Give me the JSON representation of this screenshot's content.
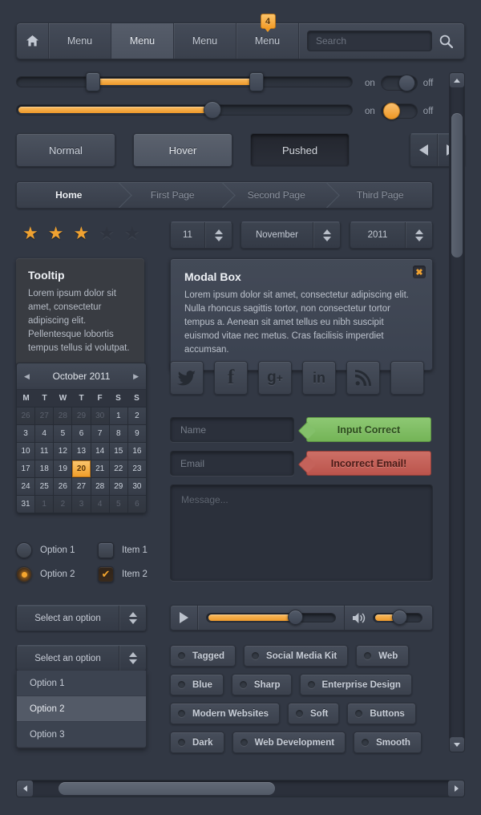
{
  "colors": {
    "background": "#323844",
    "panel": "#3d4450",
    "accent_orange": "#f0a231",
    "success_green": "#7ab85c",
    "error_red": "#c2605a",
    "text": "#c9ced8"
  },
  "topnav": {
    "home_icon": "home-icon",
    "items": [
      {
        "label": "Menu",
        "active": false
      },
      {
        "label": "Menu",
        "active": true
      },
      {
        "label": "Menu",
        "active": false
      },
      {
        "label": "Menu",
        "active": false,
        "badge": "4"
      }
    ],
    "badge": "4",
    "search": {
      "value": "",
      "placeholder": "Search",
      "icon": "search-icon"
    }
  },
  "sliders": [
    {
      "name": "range-slider",
      "start_pct": 20,
      "end_pct": 70
    },
    {
      "name": "value-slider",
      "value_pct": 57
    }
  ],
  "toggles": [
    {
      "on_label": "on",
      "off_label": "off",
      "state": "off"
    },
    {
      "on_label": "on",
      "off_label": "off",
      "state": "on"
    }
  ],
  "state_buttons": [
    {
      "label": "Normal",
      "state": "normal"
    },
    {
      "label": "Hover",
      "state": "hover"
    },
    {
      "label": "Pushed",
      "state": "pushed"
    }
  ],
  "pager": {
    "prev_icon": "arrow-left-icon",
    "next_icon": "arrow-right-icon"
  },
  "breadcrumb": [
    {
      "label": "Home",
      "active": true
    },
    {
      "label": "First Page",
      "active": false
    },
    {
      "label": "Second Page",
      "active": false
    },
    {
      "label": "Third Page",
      "active": false
    }
  ],
  "rating": {
    "filled": 3,
    "total": 5
  },
  "spinners": [
    {
      "name": "day-spinner",
      "value": "11"
    },
    {
      "name": "month-spinner",
      "value": "November"
    },
    {
      "name": "year-spinner",
      "value": "2011"
    }
  ],
  "tooltip": {
    "title": "Tooltip",
    "body": "Lorem ipsum dolor sit amet, consectetur adipiscing elit. Pellentesque lobortis tempus tellus id volutpat."
  },
  "modal": {
    "title": "Modal Box",
    "body": "Lorem ipsum dolor sit amet, consectetur adipiscing elit. Nulla rhoncus sagittis tortor, non consectetur tortor tempus a. Aenean sit amet tellus eu nibh suscipit euismod vitae nec metus. Cras facilisis imperdiet accumsan.",
    "close_label": "✖"
  },
  "calendar": {
    "title": "October 2011",
    "prev_icon": "chevron-left-icon",
    "next_icon": "chevron-right-icon",
    "dow": [
      "M",
      "T",
      "W",
      "T",
      "F",
      "S",
      "S"
    ],
    "selected": 20,
    "weeks": [
      [
        {
          "d": "26",
          "mute": true
        },
        {
          "d": "27",
          "mute": true
        },
        {
          "d": "28",
          "mute": true
        },
        {
          "d": "29",
          "mute": true
        },
        {
          "d": "30",
          "mute": true
        },
        {
          "d": "1"
        },
        {
          "d": "2"
        }
      ],
      [
        {
          "d": "3"
        },
        {
          "d": "4"
        },
        {
          "d": "5"
        },
        {
          "d": "6"
        },
        {
          "d": "7"
        },
        {
          "d": "8"
        },
        {
          "d": "9"
        }
      ],
      [
        {
          "d": "10"
        },
        {
          "d": "11"
        },
        {
          "d": "12"
        },
        {
          "d": "13"
        },
        {
          "d": "14"
        },
        {
          "d": "15"
        },
        {
          "d": "16"
        }
      ],
      [
        {
          "d": "17"
        },
        {
          "d": "18"
        },
        {
          "d": "19"
        },
        {
          "d": "20",
          "sel": true
        },
        {
          "d": "21"
        },
        {
          "d": "22"
        },
        {
          "d": "23"
        }
      ],
      [
        {
          "d": "24"
        },
        {
          "d": "25"
        },
        {
          "d": "26"
        },
        {
          "d": "27"
        },
        {
          "d": "28"
        },
        {
          "d": "29"
        },
        {
          "d": "30"
        }
      ],
      [
        {
          "d": "31"
        },
        {
          "d": "1",
          "mute": true
        },
        {
          "d": "2",
          "mute": true
        },
        {
          "d": "3",
          "mute": true
        },
        {
          "d": "4",
          "mute": true
        },
        {
          "d": "5",
          "mute": true
        },
        {
          "d": "6",
          "mute": true
        }
      ]
    ]
  },
  "radios": [
    {
      "label": "Option 1",
      "selected": false
    },
    {
      "label": "Option 2",
      "selected": true
    }
  ],
  "checkboxes": [
    {
      "label": "Item 1",
      "checked": false
    },
    {
      "label": "Item 2",
      "checked": true,
      "glyph": "✔"
    }
  ],
  "selects": [
    {
      "label": "Select an option",
      "open": false
    },
    {
      "label": "Select an option",
      "open": true
    }
  ],
  "dropdown_options": [
    {
      "label": "Option 1",
      "highlighted": false
    },
    {
      "label": "Option 2",
      "highlighted": true
    },
    {
      "label": "Option 3",
      "highlighted": false
    }
  ],
  "social": [
    {
      "name": "twitter-icon",
      "glyph": "🐦"
    },
    {
      "name": "facebook-icon",
      "glyph": "f"
    },
    {
      "name": "google-plus-icon",
      "glyph": "g+"
    },
    {
      "name": "linkedin-icon",
      "glyph": "in"
    },
    {
      "name": "rss-icon",
      "glyph": "⦿"
    },
    {
      "name": "blank-icon",
      "glyph": ""
    }
  ],
  "form": {
    "name_field": {
      "value": "",
      "placeholder": "Name"
    },
    "email_field": {
      "value": "",
      "placeholder": "Email"
    },
    "message_field": {
      "value": "",
      "placeholder": "Message..."
    },
    "success_flag": "Input Correct",
    "error_flag": "Incorrect Email!"
  },
  "player": {
    "play_icon": "play-icon",
    "volume_icon": "volume-icon",
    "progress_pct": 62,
    "volume_pct": 55
  },
  "tags": [
    {
      "label": "Tagged"
    },
    {
      "label": "Social Media Kit"
    },
    {
      "label": "Web"
    },
    {
      "label": "Blue"
    },
    {
      "label": "Sharp"
    },
    {
      "label": "Enterprise Design"
    },
    {
      "label": "Modern Websites"
    },
    {
      "label": "Soft"
    },
    {
      "label": "Buttons"
    },
    {
      "label": "Dark"
    },
    {
      "label": "Web Development"
    },
    {
      "label": "Smooth"
    }
  ],
  "scrollbars": {
    "vertical": {
      "up_icon": "arrow-up-icon",
      "down_icon": "arrow-down-icon",
      "thumb_pct": 21
    },
    "horizontal": {
      "left_icon": "arrow-left-icon",
      "right_icon": "arrow-right-icon",
      "thumb_pct": 48
    }
  }
}
